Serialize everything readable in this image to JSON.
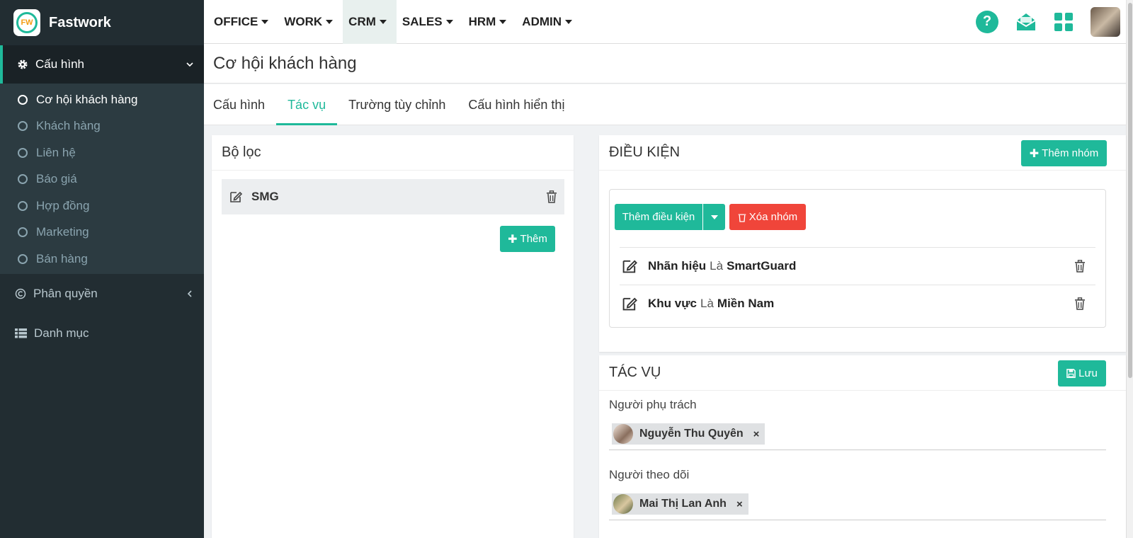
{
  "brand": {
    "name": "Fastwork",
    "logo_text": "FW"
  },
  "sidebar": {
    "section": "Cấu hình",
    "sub_items": [
      "Cơ hội khách hàng",
      "Khách hàng",
      "Liên hệ",
      "Báo giá",
      "Hợp đồng",
      "Marketing",
      "Bán hàng"
    ],
    "active_sub": "Cơ hội khách hàng",
    "items": [
      {
        "label": "Phân quyền",
        "icon": "copyright-icon"
      },
      {
        "label": "Danh mục",
        "icon": "list-icon"
      }
    ]
  },
  "nav": {
    "items": [
      "OFFICE",
      "WORK",
      "CRM",
      "SALES",
      "HRM",
      "ADMIN"
    ],
    "active": "CRM"
  },
  "top_icons": {
    "help": "?",
    "colors": {
      "accent": "#1fb99a"
    }
  },
  "page": {
    "title": "Cơ hội khách hàng"
  },
  "tabs": {
    "items": [
      "Cấu hình",
      "Tác vụ",
      "Trường tùy chỉnh",
      "Cấu hình hiển thị"
    ],
    "active": "Tác vụ"
  },
  "filter_panel": {
    "title": "Bộ lọc",
    "items": [
      {
        "name": "SMG"
      }
    ],
    "add_label": "Thêm"
  },
  "condition_panel": {
    "title": "ĐIỀU KIỆN",
    "add_group_label": "Thêm nhóm",
    "add_condition_label": "Thêm điều kiện",
    "delete_group_label": "Xóa nhóm",
    "conditions": [
      {
        "field": "Nhãn hiệu",
        "op": "Là",
        "value": "SmartGuard"
      },
      {
        "field": "Khu vực",
        "op": "Là",
        "value": "Miền Nam"
      }
    ]
  },
  "task_panel": {
    "title": "TÁC VỤ",
    "save_label": "Lưu",
    "assignee_label": "Người phụ trách",
    "assignee": "Nguyễn Thu Quyên",
    "follower_label": "Người theo dõi",
    "follower": "Mai Thị Lan Anh",
    "remove_symbol": "×"
  }
}
